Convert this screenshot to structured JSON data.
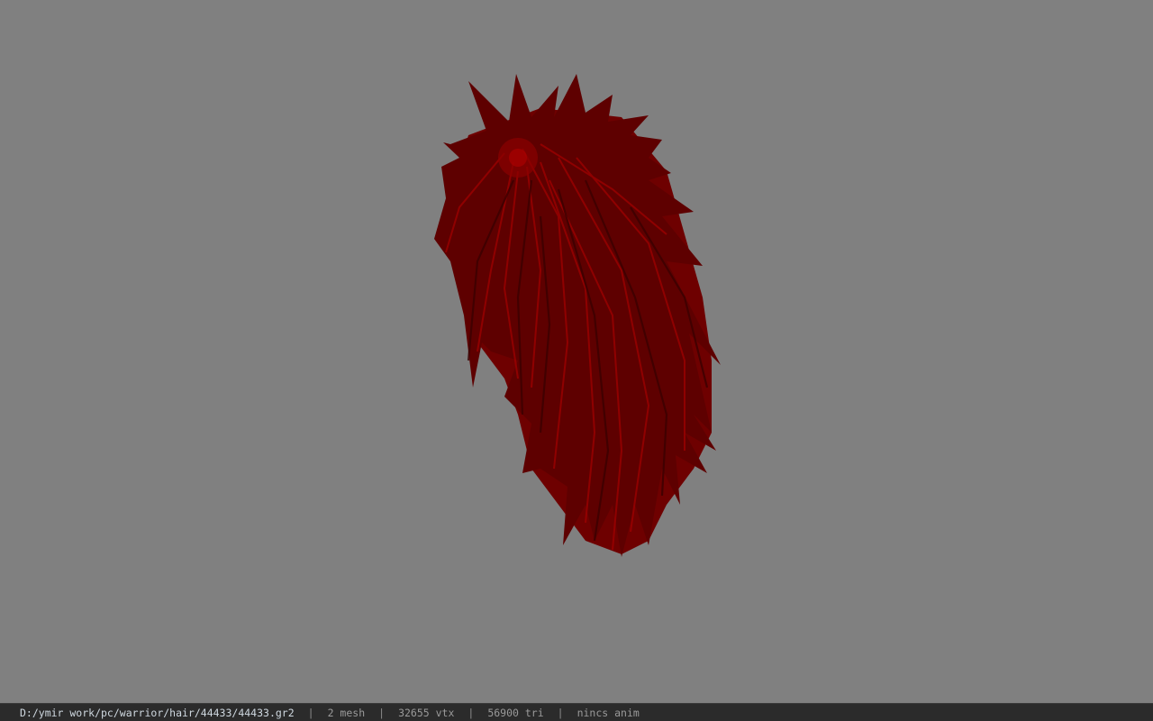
{
  "viewport": {
    "background_color": "#808080",
    "model_color": "#7a0000",
    "model_highlight_color": "#a00000",
    "model_shadow_color": "#3a0000"
  },
  "status_bar": {
    "file_path": "D:/ymir work/pc/warrior/hair/44433/44433.gr2",
    "separator": "|",
    "mesh_count": "2 mesh",
    "vertex_count": "32655 vtx",
    "triangle_count": "56900 tri",
    "anim_status": "nincs anim"
  }
}
